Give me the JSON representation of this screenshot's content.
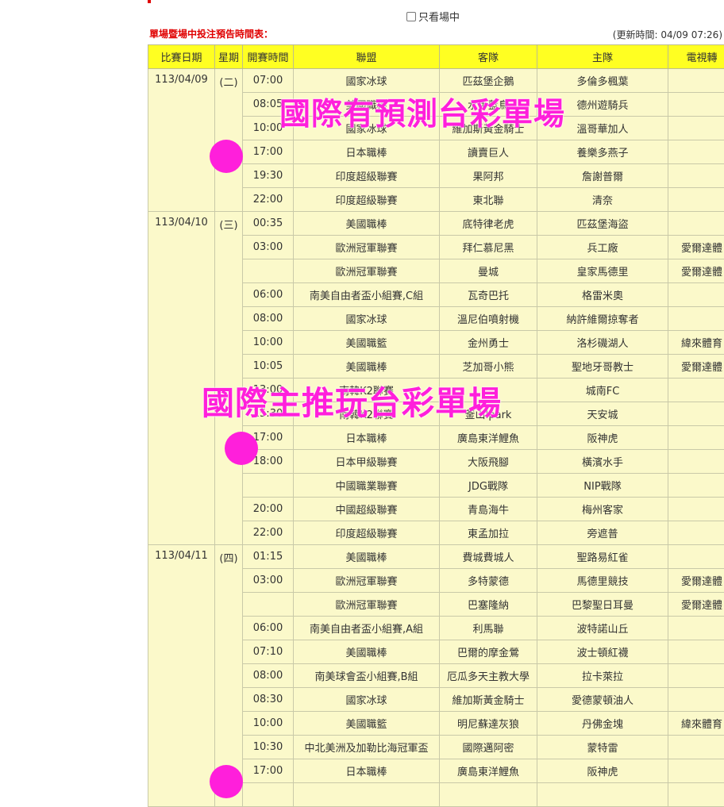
{
  "filter": {
    "only_live_label": "只看場中",
    "checked": false
  },
  "header": {
    "table_title": "單場暨場中投注預告時間表：",
    "update_time": "(更新時間: 04/09 07:26)"
  },
  "columns": [
    "比賽日期",
    "星期",
    "開賽時間",
    "聯盟",
    "客隊",
    "主隊",
    "電視轉"
  ],
  "groups": [
    {
      "date": "113/04/09",
      "weekday": "(二)",
      "rows": [
        {
          "time": "07:00",
          "league": "國家冰球",
          "away": "匹茲堡企鵝",
          "home": "多倫多楓葉",
          "tv": ""
        },
        {
          "time": "08:05",
          "league": "美國職棒",
          "away": "水手藍鳥",
          "home": "德州遊騎兵",
          "tv": ""
        },
        {
          "time": "10:00",
          "league": "國家冰球",
          "away": "維加斯黃金騎士",
          "home": "溫哥華加人",
          "tv": ""
        },
        {
          "time": "17:00",
          "league": "日本職棒",
          "away": "讀賣巨人",
          "home": "養樂多燕子",
          "tv": ""
        },
        {
          "time": "19:30",
          "league": "印度超級聯賽",
          "away": "果阿邦",
          "home": "詹謝普爾",
          "tv": ""
        },
        {
          "time": "22:00",
          "league": "印度超級聯賽",
          "away": "東北聯",
          "home": "清奈",
          "tv": ""
        }
      ]
    },
    {
      "date": "113/04/10",
      "weekday": "(三)",
      "rows": [
        {
          "time": "00:35",
          "league": "美國職棒",
          "away": "底特律老虎",
          "home": "匹茲堡海盜",
          "tv": ""
        },
        {
          "time": "03:00",
          "league": "歐洲冠軍聯賽",
          "away": "拜仁慕尼黑",
          "home": "兵工廠",
          "tv": "愛爾達體"
        },
        {
          "time": "",
          "league": "歐洲冠軍聯賽",
          "away": "曼城",
          "home": "皇家馬德里",
          "tv": "愛爾達體"
        },
        {
          "time": "06:00",
          "league": "南美自由者盃小組賽,C組",
          "away": "瓦奇巴托",
          "home": "格雷米奧",
          "tv": ""
        },
        {
          "time": "08:00",
          "league": "國家冰球",
          "away": "溫尼伯噴射機",
          "home": "納許維爾掠奪者",
          "tv": ""
        },
        {
          "time": "10:00",
          "league": "美國職籃",
          "away": "金州勇士",
          "home": "洛杉磯湖人",
          "tv": "緯來體育"
        },
        {
          "time": "10:05",
          "league": "美國職棒",
          "away": "芝加哥小熊",
          "home": "聖地牙哥教士",
          "tv": "愛爾達體"
        },
        {
          "time": "13:00",
          "league": "南韓K2聯賽",
          "away": "",
          "home": "城南FC",
          "tv": ""
        },
        {
          "time": "15:30",
          "league": "南韓K2聯賽",
          "away": "釜山Ipark",
          "home": "天安城",
          "tv": ""
        },
        {
          "time": "17:00",
          "league": "日本職棒",
          "away": "廣島東洋鯉魚",
          "home": "阪神虎",
          "tv": ""
        },
        {
          "time": "18:00",
          "league": "日本甲級聯賽",
          "away": "大阪飛腳",
          "home": "橫濱水手",
          "tv": ""
        },
        {
          "time": "",
          "league": "中國職業聯賽",
          "away": "JDG戰隊",
          "home": "NIP戰隊",
          "tv": ""
        },
        {
          "time": "20:00",
          "league": "中國超級聯賽",
          "away": "青島海牛",
          "home": "梅州客家",
          "tv": ""
        },
        {
          "time": "22:00",
          "league": "印度超級聯賽",
          "away": "東孟加拉",
          "home": "旁遮普",
          "tv": ""
        }
      ]
    },
    {
      "date": "113/04/11",
      "weekday": "(四)",
      "rows": [
        {
          "time": "01:15",
          "league": "美國職棒",
          "away": "費城費城人",
          "home": "聖路易紅雀",
          "tv": ""
        },
        {
          "time": "03:00",
          "league": "歐洲冠軍聯賽",
          "away": "多特蒙德",
          "home": "馬德里競技",
          "tv": "愛爾達體"
        },
        {
          "time": "",
          "league": "歐洲冠軍聯賽",
          "away": "巴塞隆納",
          "home": "巴黎聖日耳曼",
          "tv": "愛爾達體"
        },
        {
          "time": "06:00",
          "league": "南美自由者盃小組賽,A組",
          "away": "利馬聯",
          "home": "波特諾山丘",
          "tv": ""
        },
        {
          "time": "07:10",
          "league": "美國職棒",
          "away": "巴爾的摩金鶯",
          "home": "波士頓紅襪",
          "tv": ""
        },
        {
          "time": "08:00",
          "league": "南美球會盃小組賽,B組",
          "away": "厄瓜多天主教大學",
          "home": "拉卡萊拉",
          "tv": ""
        },
        {
          "time": "08:30",
          "league": "國家冰球",
          "away": "維加斯黃金騎士",
          "home": "愛德蒙頓油人",
          "tv": ""
        },
        {
          "time": "10:00",
          "league": "美國職籃",
          "away": "明尼蘇達灰狼",
          "home": "丹佛金塊",
          "tv": "緯來體育"
        },
        {
          "time": "10:30",
          "league": "中北美洲及加勒比海冠軍盃",
          "away": "國際邁阿密",
          "home": "蒙特雷",
          "tv": ""
        },
        {
          "time": "17:00",
          "league": "日本職棒",
          "away": "廣島東洋鯉魚",
          "home": "阪神虎",
          "tv": ""
        },
        {
          "time": "",
          "league": "",
          "away": "",
          "home": "",
          "tv": ""
        }
      ]
    }
  ],
  "overlays": {
    "banner_top": "國際有預測台彩單場",
    "banner_mid": "國際主推玩台彩單場"
  }
}
